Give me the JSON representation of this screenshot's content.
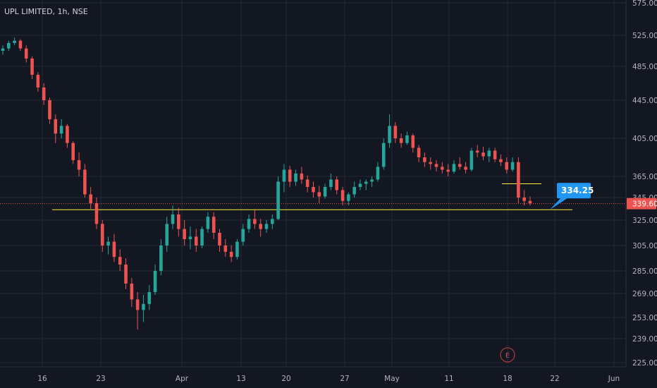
{
  "chart_data": {
    "type": "candlestick",
    "title": "UPL LIMITED, 1h, NSE",
    "ylim": [
      221,
      575
    ],
    "y_ticks": [
      225,
      239,
      253,
      269,
      285,
      305,
      325,
      345,
      365,
      405,
      445,
      485,
      525,
      575
    ],
    "y_tick_labels": [
      "225.00",
      "239.00",
      "253.00",
      "269.00",
      "285.00",
      "305.00",
      "325.00",
      "345.00",
      "365.00",
      "405.00",
      "445.00",
      "485.00",
      "525.00",
      "575.00"
    ],
    "x_tick_labels": [
      "16",
      "23",
      "Apr",
      "13",
      "20",
      "27",
      "May",
      "11",
      "18",
      "22",
      "Jun"
    ],
    "series": [
      {
        "values": [
          [
            505,
            512,
            500,
            508
          ],
          [
            508,
            518,
            505,
            515
          ],
          [
            515,
            522,
            512,
            518
          ],
          [
            518,
            520,
            505,
            508
          ],
          [
            508,
            512,
            490,
            495
          ],
          [
            495,
            498,
            470,
            475
          ],
          [
            475,
            478,
            455,
            460
          ],
          [
            460,
            465,
            440,
            445
          ],
          [
            445,
            448,
            420,
            425
          ],
          [
            425,
            430,
            400,
            410
          ],
          [
            410,
            425,
            405,
            418
          ],
          [
            418,
            420,
            395,
            400
          ],
          [
            400,
            402,
            378,
            382
          ],
          [
            382,
            390,
            365,
            372
          ],
          [
            372,
            378,
            345,
            348
          ],
          [
            348,
            355,
            335,
            340
          ],
          [
            340,
            345,
            318,
            322
          ],
          [
            322,
            325,
            300,
            305
          ],
          [
            305,
            312,
            298,
            308
          ],
          [
            308,
            314,
            292,
            296
          ],
          [
            296,
            302,
            285,
            290
          ],
          [
            290,
            295,
            272,
            276
          ],
          [
            276,
            280,
            260,
            265
          ],
          [
            265,
            270,
            245,
            258
          ],
          [
            258,
            268,
            250,
            262
          ],
          [
            262,
            275,
            258,
            270
          ],
          [
            270,
            290,
            268,
            285
          ],
          [
            285,
            310,
            282,
            305
          ],
          [
            305,
            328,
            300,
            322
          ],
          [
            322,
            338,
            318,
            330
          ],
          [
            330,
            336,
            312,
            318
          ],
          [
            318,
            325,
            305,
            310
          ],
          [
            310,
            320,
            302,
            312
          ],
          [
            312,
            318,
            300,
            305
          ],
          [
            305,
            320,
            303,
            318
          ],
          [
            318,
            332,
            315,
            328
          ],
          [
            328,
            332,
            310,
            315
          ],
          [
            315,
            318,
            300,
            305
          ],
          [
            305,
            310,
            296,
            300
          ],
          [
            300,
            305,
            292,
            296
          ],
          [
            296,
            310,
            294,
            308
          ],
          [
            308,
            322,
            305,
            318
          ],
          [
            318,
            330,
            315,
            326
          ],
          [
            326,
            334,
            318,
            322
          ],
          [
            322,
            326,
            312,
            318
          ],
          [
            318,
            325,
            315,
            322
          ],
          [
            322,
            330,
            318,
            326
          ],
          [
            326,
            365,
            325,
            360
          ],
          [
            360,
            378,
            350,
            372
          ],
          [
            372,
            376,
            355,
            360
          ],
          [
            360,
            372,
            356,
            368
          ],
          [
            368,
            375,
            358,
            362
          ],
          [
            362,
            366,
            350,
            355
          ],
          [
            355,
            360,
            345,
            350
          ],
          [
            350,
            356,
            340,
            346
          ],
          [
            346,
            358,
            344,
            355
          ],
          [
            355,
            368,
            352,
            362
          ],
          [
            362,
            365,
            348,
            352
          ],
          [
            352,
            355,
            338,
            342
          ],
          [
            342,
            350,
            338,
            348
          ],
          [
            348,
            360,
            345,
            355
          ],
          [
            355,
            362,
            352,
            358
          ],
          [
            358,
            362,
            352,
            360
          ],
          [
            360,
            365,
            355,
            362
          ],
          [
            362,
            380,
            360,
            375
          ],
          [
            375,
            405,
            372,
            400
          ],
          [
            400,
            430,
            395,
            418
          ],
          [
            418,
            422,
            400,
            405
          ],
          [
            405,
            410,
            395,
            400
          ],
          [
            400,
            412,
            398,
            408
          ],
          [
            408,
            410,
            390,
            395
          ],
          [
            395,
            398,
            380,
            385
          ],
          [
            385,
            390,
            375,
            380
          ],
          [
            380,
            385,
            372,
            378
          ],
          [
            378,
            382,
            370,
            375
          ],
          [
            375,
            380,
            368,
            372
          ],
          [
            372,
            378,
            365,
            370
          ],
          [
            370,
            382,
            368,
            378
          ],
          [
            378,
            385,
            372,
            375
          ],
          [
            375,
            380,
            368,
            372
          ],
          [
            372,
            395,
            370,
            392
          ],
          [
            392,
            398,
            385,
            390
          ],
          [
            390,
            396,
            382,
            386
          ],
          [
            386,
            395,
            380,
            392
          ],
          [
            392,
            395,
            380,
            383
          ],
          [
            383,
            388,
            376,
            380
          ],
          [
            380,
            385,
            368,
            372
          ],
          [
            372,
            385,
            370,
            380
          ],
          [
            380,
            385,
            340,
            345
          ],
          [
            345,
            352,
            338,
            342
          ],
          [
            342,
            346,
            338,
            340
          ]
        ]
      }
    ],
    "horizontal_lines": [
      334.25,
      358
    ],
    "last_price": 339.6,
    "last_price_label": "339.60",
    "callout_label": "334.25",
    "event_marker": "E",
    "colors": {
      "up": "#26a69a",
      "down": "#ef5350",
      "level_line": "#ffeb3b",
      "price_line": "#ef5350",
      "callout": "#2196f3"
    }
  }
}
